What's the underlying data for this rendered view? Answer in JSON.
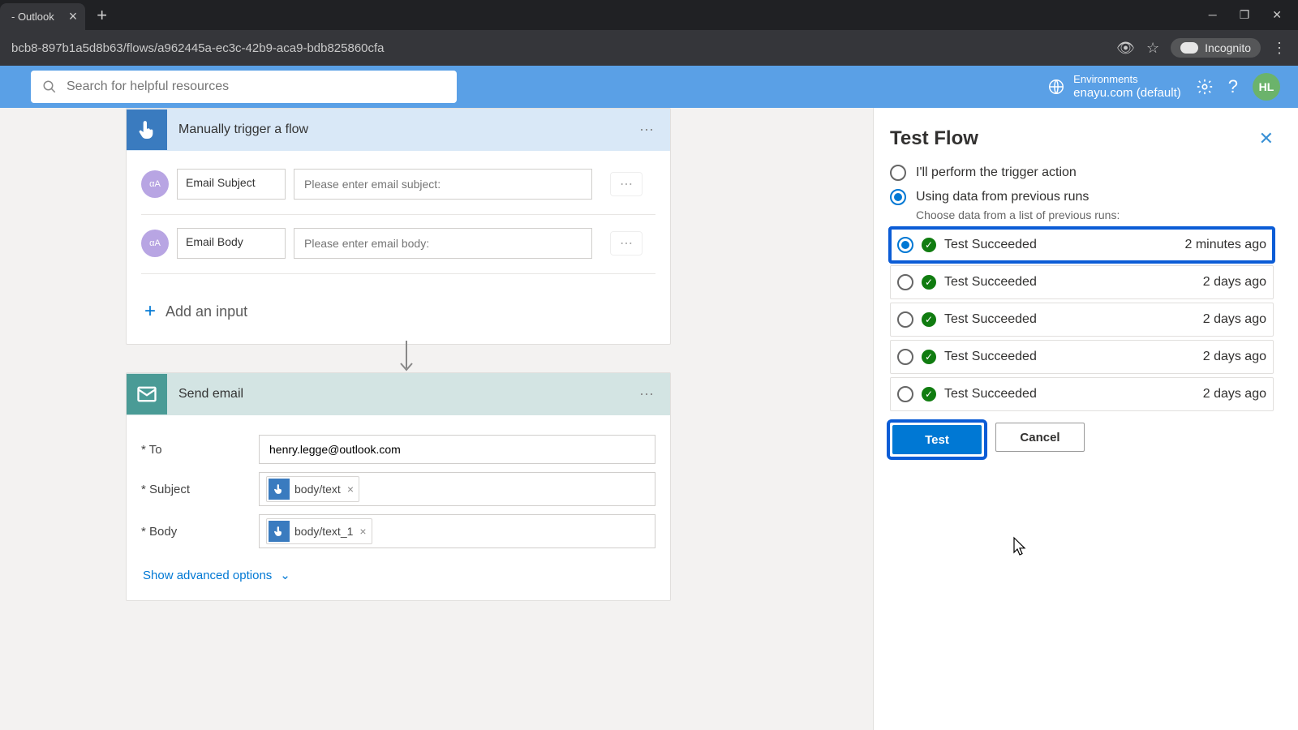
{
  "browser": {
    "tab_title": "- Outlook",
    "url": "bcb8-897b1a5d8b63/flows/a962445a-ec3c-42b9-aca9-bdb825860cfa",
    "incognito": "Incognito"
  },
  "header": {
    "search_placeholder": "Search for helpful resources",
    "env_label": "Environments",
    "env_name": "enayu.com (default)",
    "avatar": "HL"
  },
  "trigger_card": {
    "title": "Manually trigger a flow",
    "inputs": [
      {
        "label": "Email Subject",
        "placeholder": "Please enter email subject:"
      },
      {
        "label": "Email Body",
        "placeholder": "Please enter email body:"
      }
    ],
    "add_input": "Add an input"
  },
  "action_card": {
    "title": "Send email",
    "fields": {
      "to_label": "* To",
      "to_value": "henry.legge@outlook.com",
      "subject_label": "* Subject",
      "subject_token": "body/text",
      "body_label": "* Body",
      "body_token": "body/text_1"
    },
    "show_advanced": "Show advanced options"
  },
  "panel": {
    "title": "Test Flow",
    "option_manual": "I'll perform the trigger action",
    "option_previous": "Using data from previous runs",
    "choose_hint": "Choose data from a list of previous runs:",
    "runs": [
      {
        "label": "Test Succeeded",
        "time": "2 minutes ago",
        "selected": true,
        "highlighted": true
      },
      {
        "label": "Test Succeeded",
        "time": "2 days ago",
        "selected": false,
        "highlighted": false
      },
      {
        "label": "Test Succeeded",
        "time": "2 days ago",
        "selected": false,
        "highlighted": false
      },
      {
        "label": "Test Succeeded",
        "time": "2 days ago",
        "selected": false,
        "highlighted": false
      },
      {
        "label": "Test Succeeded",
        "time": "2 days ago",
        "selected": false,
        "highlighted": false
      }
    ],
    "test_btn": "Test",
    "cancel_btn": "Cancel"
  }
}
